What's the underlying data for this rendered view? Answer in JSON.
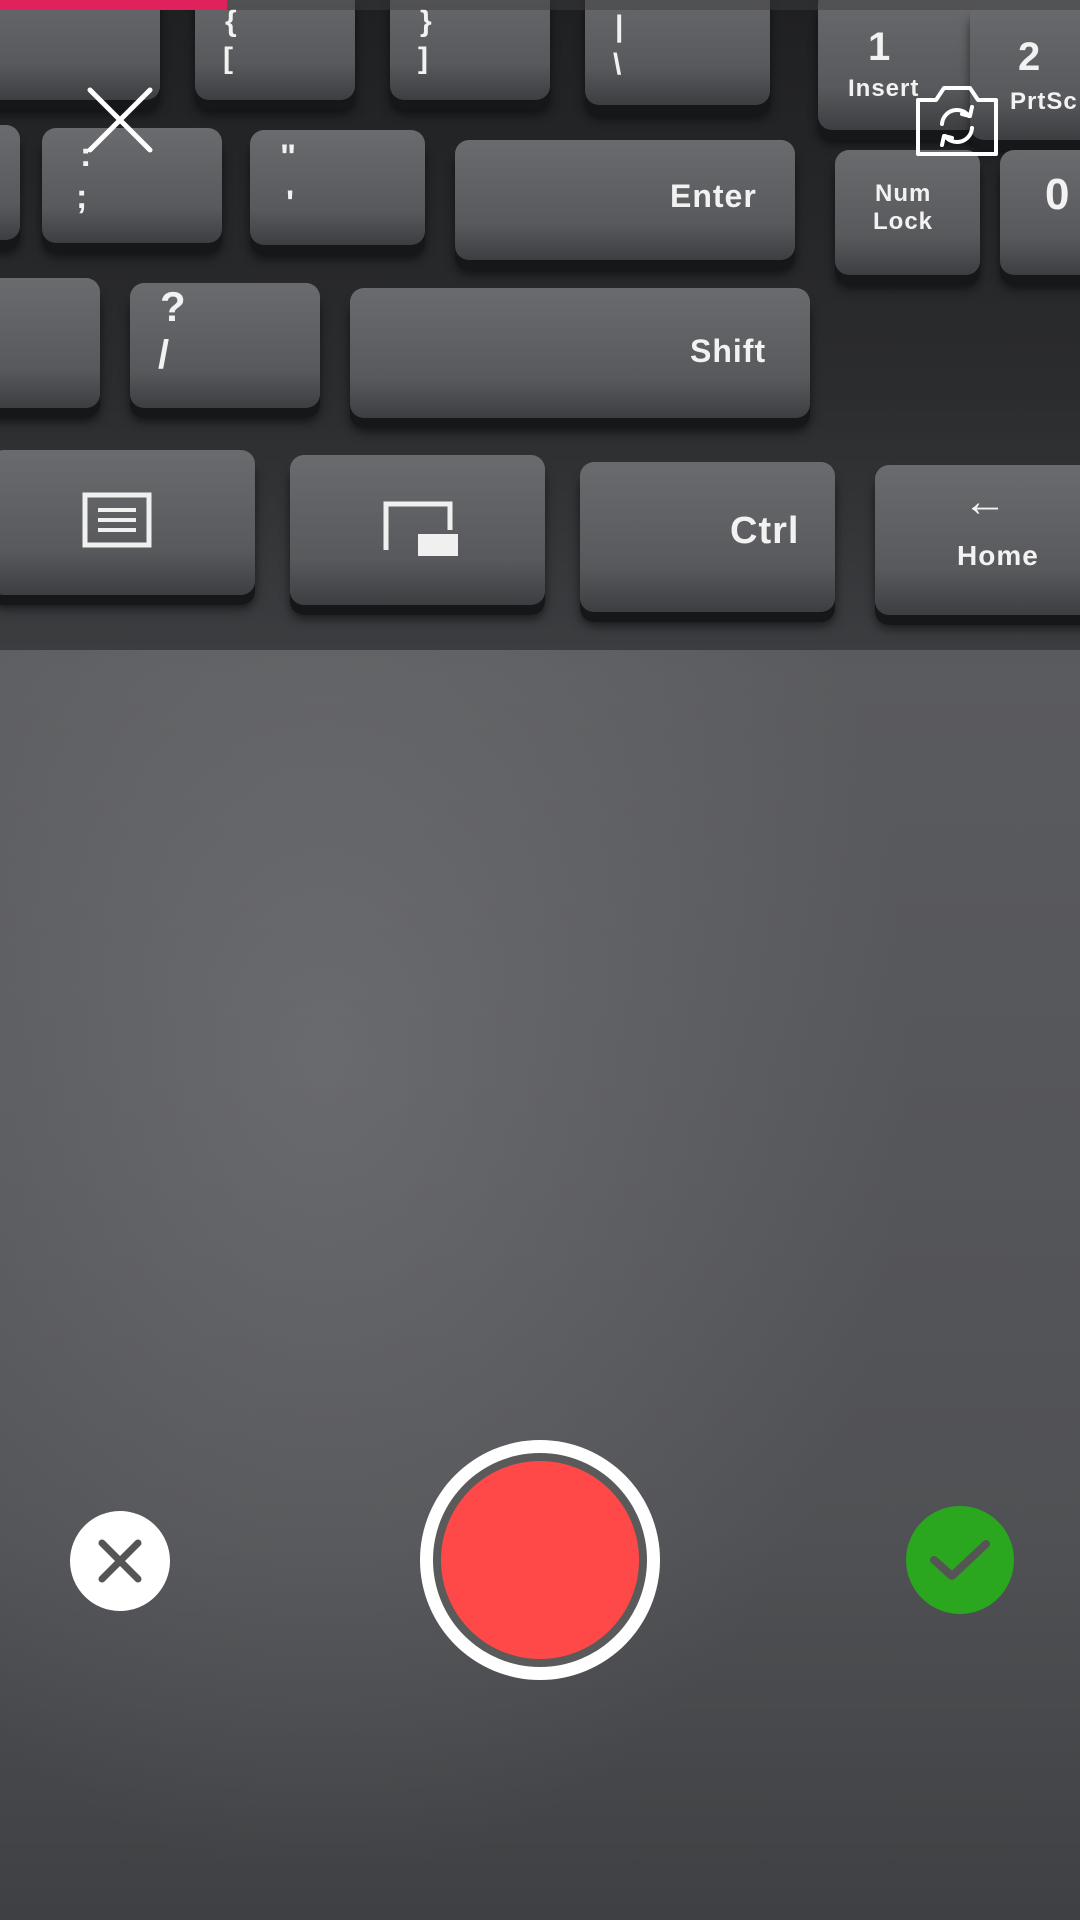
{
  "camera_ui": {
    "recording_progress": 0.21,
    "colors": {
      "progress": "#e0225c",
      "shutter": "#ff4848",
      "confirm": "#2aa61f",
      "discard": "#ffffff"
    },
    "top_bar": {
      "close_icon": "close-icon",
      "flip_icon": "camera-flip-icon"
    },
    "bottom_bar": {
      "discard_icon": "x-icon",
      "shutter_icon": "record-icon",
      "confirm_icon": "checkmark-icon"
    }
  },
  "scene": {
    "keys": {
      "bracket_top": "{",
      "bracket_bottom": "[",
      "brace_top": "}",
      "brace_bottom": "]",
      "pipe_top": "|",
      "pipe_bottom": "\\",
      "colon": ":",
      "semicolon": ";",
      "quote_top": "\"",
      "quote_bottom": "'",
      "enter": "Enter",
      "question": "?",
      "slash": "/",
      "shift": "Shift",
      "ctrl": "Ctrl",
      "home_arrow": "←",
      "home": "Home",
      "one": "1",
      "insert": "Insert",
      "two": "2",
      "prtsc": "PrtSc",
      "num_lock_1": "Num",
      "num_lock_2": "Lock",
      "zero": "0"
    }
  }
}
